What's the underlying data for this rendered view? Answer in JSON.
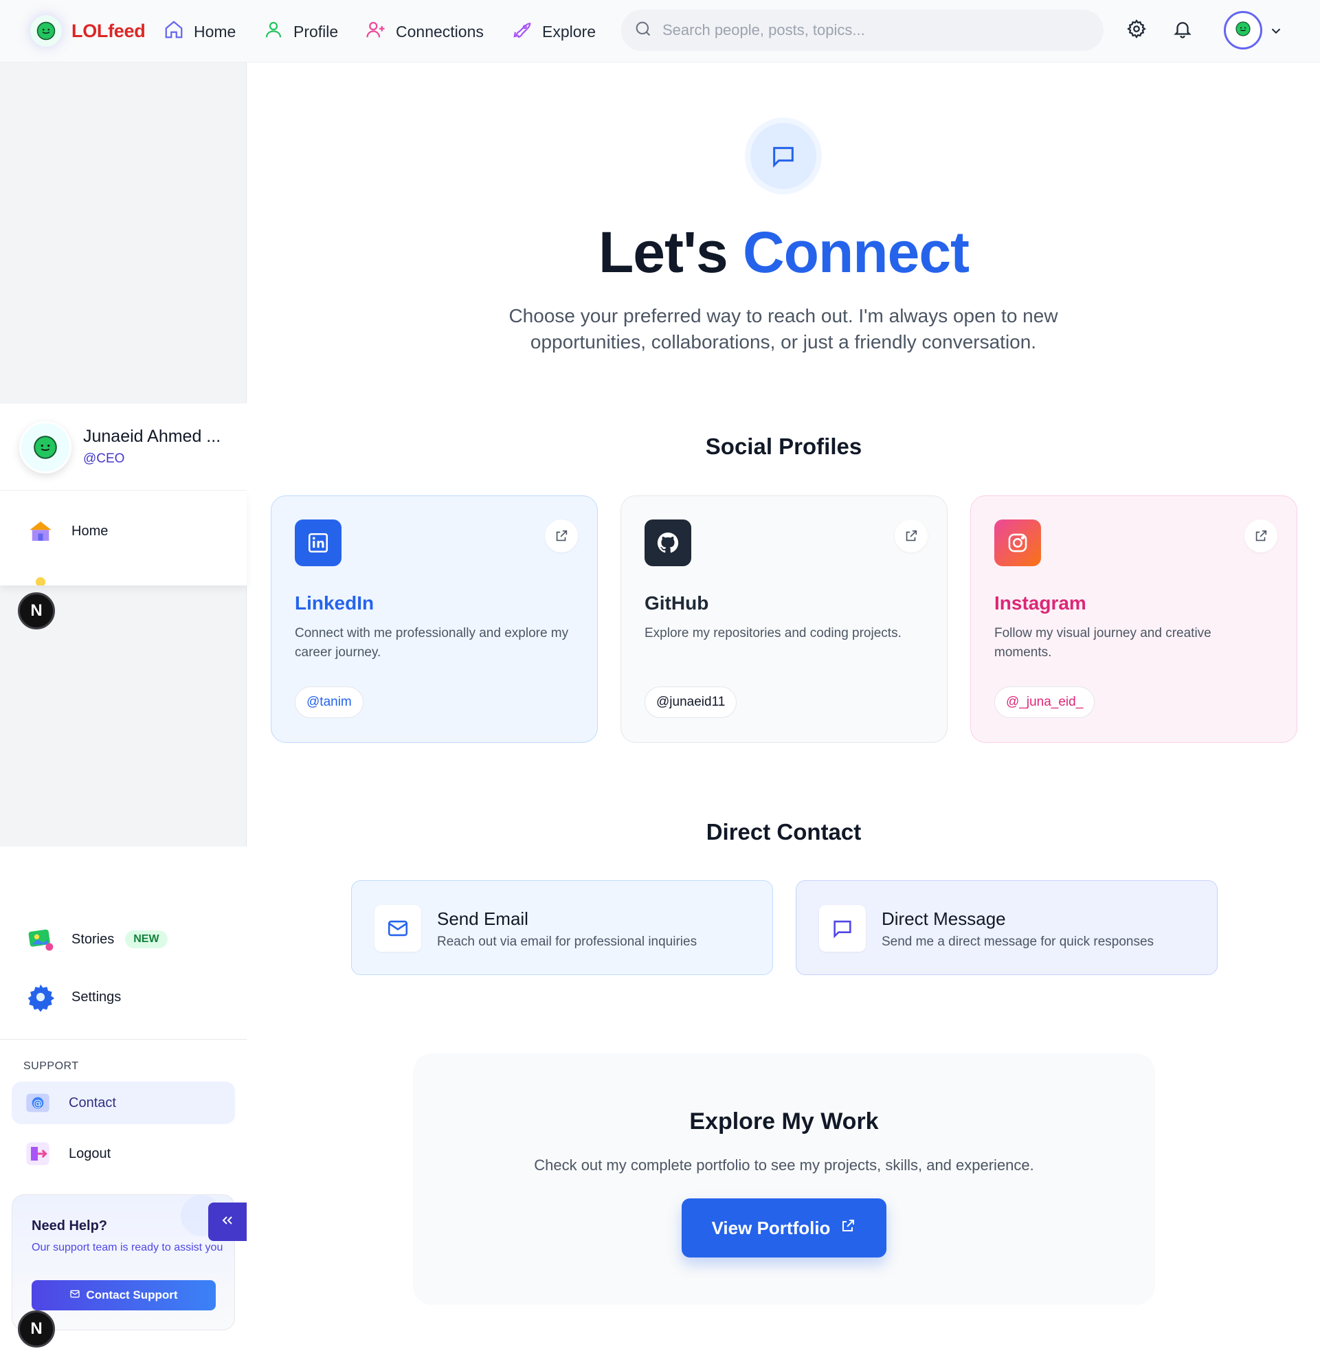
{
  "brand": {
    "name": "LOLfeed",
    "accent": "#dc2626"
  },
  "nav": {
    "items": [
      {
        "label": "Home",
        "icon": "home-icon"
      },
      {
        "label": "Profile",
        "icon": "user-icon"
      },
      {
        "label": "Connections",
        "icon": "user-plus-icon"
      },
      {
        "label": "Explore",
        "icon": "rocket-icon"
      }
    ],
    "search_placeholder": "Search people, posts, topics..."
  },
  "sidebar": {
    "user": {
      "name": "Junaeid Ahmed ...",
      "handle": "@CEO"
    },
    "menu": [
      {
        "label": "Home",
        "icon": "house-3d-icon"
      },
      {
        "label": "Stories",
        "icon": "stories-icon",
        "badge": "NEW"
      },
      {
        "label": "Settings",
        "icon": "gear-icon"
      }
    ],
    "support_heading": "SUPPORT",
    "support_items": [
      {
        "label": "Contact",
        "icon": "at-sign-icon",
        "active": true
      },
      {
        "label": "Logout",
        "icon": "logout-icon"
      }
    ],
    "help": {
      "title": "Need Help?",
      "subtitle": "Our support team is ready to assist you",
      "button": "Contact Support"
    },
    "dev_badge": "N"
  },
  "main": {
    "hero": {
      "title_plain": "Let's",
      "title_accent": "Connect",
      "subtitle": "Choose your preferred way to reach out. I'm always open to new opportunities, collaborations, or just a friendly conversation."
    },
    "social_heading": "Social Profiles",
    "social": [
      {
        "name": "LinkedIn",
        "description": "Connect with me professionally and explore my career journey.",
        "handle": "@tanim",
        "color": "#2563eb"
      },
      {
        "name": "GitHub",
        "description": "Explore my repositories and coding projects.",
        "handle": "@junaeid11",
        "color": "#1f2937"
      },
      {
        "name": "Instagram",
        "description": "Follow my visual journey and creative moments.",
        "handle": "@_juna_eid_",
        "color": "#db2777"
      }
    ],
    "direct_heading": "Direct Contact",
    "direct": [
      {
        "title": "Send Email",
        "subtitle": "Reach out via email for professional inquiries",
        "icon": "mail-icon"
      },
      {
        "title": "Direct Message",
        "subtitle": "Send me a direct message for quick responses",
        "icon": "message-icon"
      }
    ],
    "work": {
      "title": "Explore My Work",
      "subtitle": "Check out my complete portfolio to see my projects, skills, and experience.",
      "button": "View Portfolio"
    }
  }
}
